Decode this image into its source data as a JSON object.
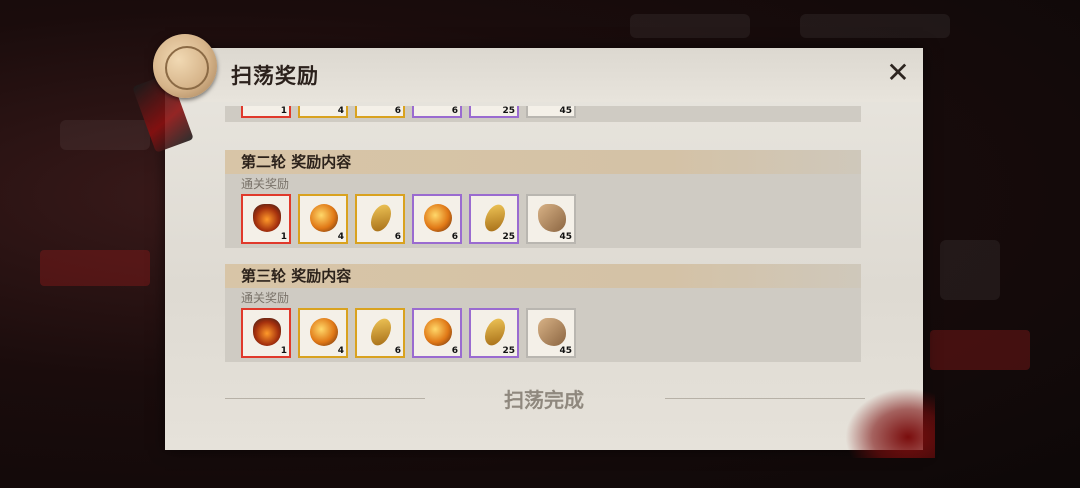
{
  "dialog": {
    "title": "扫荡奖励",
    "close_label": "✕",
    "footer_text": "扫荡完成"
  },
  "rounds": [
    {
      "title": "",
      "sub_label": "",
      "items": [
        {
          "icon": "crown-orb-icon",
          "rarity": "red",
          "qty": "1"
        },
        {
          "icon": "fire-orb-icon",
          "rarity": "gold",
          "qty": "4"
        },
        {
          "icon": "amber-shard-icon",
          "rarity": "gold",
          "qty": "6"
        },
        {
          "icon": "fire-orb-icon",
          "rarity": "purple",
          "qty": "6"
        },
        {
          "icon": "amber-shard-icon",
          "rarity": "purple",
          "qty": "25"
        },
        {
          "icon": "ore-stone-icon",
          "rarity": "white",
          "qty": "45"
        }
      ]
    },
    {
      "title": "第二轮 奖励内容",
      "sub_label": "通关奖励",
      "items": [
        {
          "icon": "crown-orb-icon",
          "rarity": "red",
          "qty": "1"
        },
        {
          "icon": "fire-orb-icon",
          "rarity": "gold",
          "qty": "4"
        },
        {
          "icon": "amber-shard-icon",
          "rarity": "gold",
          "qty": "6"
        },
        {
          "icon": "fire-orb-icon",
          "rarity": "purple",
          "qty": "6"
        },
        {
          "icon": "amber-shard-icon",
          "rarity": "purple",
          "qty": "25"
        },
        {
          "icon": "ore-stone-icon",
          "rarity": "white",
          "qty": "45"
        }
      ]
    },
    {
      "title": "第三轮 奖励内容",
      "sub_label": "通关奖励",
      "items": [
        {
          "icon": "crown-orb-icon",
          "rarity": "red",
          "qty": "1"
        },
        {
          "icon": "fire-orb-icon",
          "rarity": "gold",
          "qty": "4"
        },
        {
          "icon": "amber-shard-icon",
          "rarity": "gold",
          "qty": "6"
        },
        {
          "icon": "fire-orb-icon",
          "rarity": "purple",
          "qty": "6"
        },
        {
          "icon": "amber-shard-icon",
          "rarity": "purple",
          "qty": "25"
        },
        {
          "icon": "ore-stone-icon",
          "rarity": "white",
          "qty": "45"
        }
      ]
    }
  ],
  "colors": {
    "red": "#e0392b",
    "gold": "#d9a21f",
    "purple": "#9a6bd0",
    "white": "#b9b6b0"
  }
}
